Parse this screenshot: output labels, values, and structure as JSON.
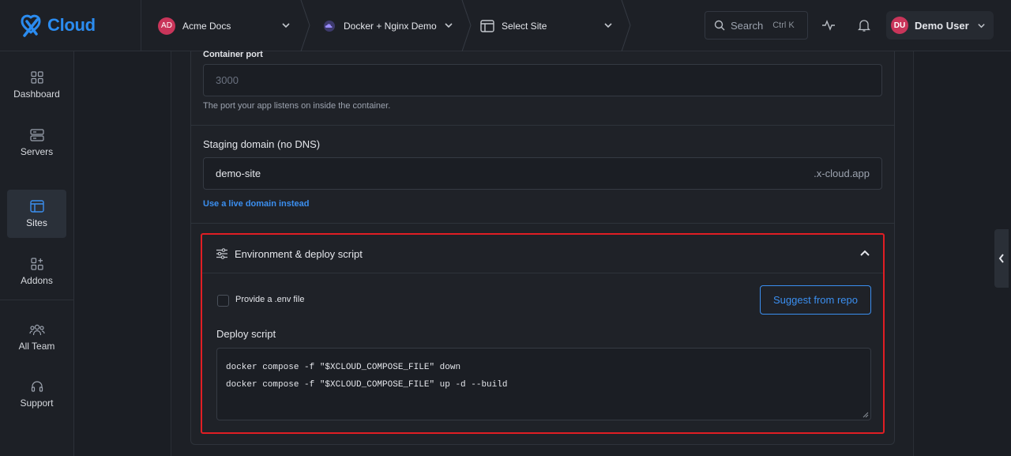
{
  "brand": {
    "name": "Cloud",
    "accent": "#2b8cf0"
  },
  "breadcrumbs": [
    {
      "avatar": "AD",
      "label": "Acme Docs",
      "icon": "avatar"
    },
    {
      "label": "Docker + Nginx Demo",
      "icon": "cloud-icon"
    },
    {
      "label": "Select Site",
      "icon": "site-layout-icon"
    }
  ],
  "search": {
    "label": "Search",
    "shortcut": "Ctrl K"
  },
  "user": {
    "initials": "DU",
    "name": "Demo User"
  },
  "sidebar": {
    "items": [
      {
        "label": "Dashboard",
        "icon": "dashboard-icon",
        "active": false
      },
      {
        "label": "Servers",
        "icon": "server-icon",
        "active": false
      },
      {
        "label": "Sites",
        "icon": "sites-icon",
        "active": true
      },
      {
        "label": "Addons",
        "icon": "addons-icon",
        "active": false
      },
      {
        "label": "All Team",
        "icon": "team-icon",
        "active": false
      },
      {
        "label": "Support",
        "icon": "headset-icon",
        "active": false
      }
    ]
  },
  "form": {
    "container_port": {
      "label": "Container port",
      "placeholder": "3000",
      "help": "The port your app listens on inside the container."
    },
    "staging_domain": {
      "label": "Staging domain (no DNS)",
      "value": "demo-site",
      "suffix": ".x-cloud.app",
      "link": "Use a live domain instead"
    },
    "env_section": {
      "title": "Environment & deploy script",
      "env_checkbox_label": "Provide a .env file",
      "env_checked": false,
      "suggest_button": "Suggest from repo",
      "deploy_label": "Deploy script",
      "deploy_script_lines": [
        "docker compose -f \"$XCLOUD_COMPOSE_FILE\" down",
        "docker compose -f \"$XCLOUD_COMPOSE_FILE\" up -d --build"
      ]
    }
  },
  "colors": {
    "highlight_border": "#e01e24",
    "link": "#3b8ff0"
  }
}
